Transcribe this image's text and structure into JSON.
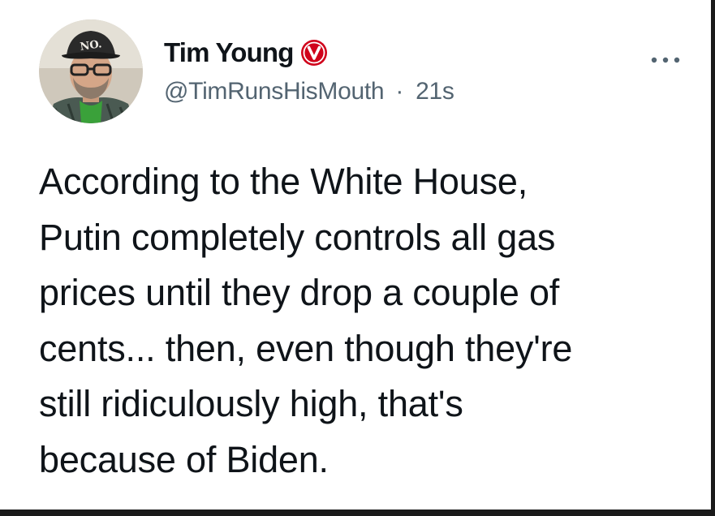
{
  "tweet": {
    "author": {
      "name": "Tim Young",
      "handle": "@TimRunsHisMouth",
      "avatar_hat_text": "NO.",
      "verified_icon": "verified-v-badge-icon",
      "verified_color": "#d0021b"
    },
    "separator": "·",
    "time_ago": "21s",
    "more_icon": "more-options-icon",
    "text_lines": [
      "According to the White House,",
      "Putin completely controls all gas",
      "prices until they drop a couple of",
      "cents... then, even though they're",
      "still ridiculously high, that's",
      "because of Biden."
    ]
  },
  "colors": {
    "text_primary": "#0f1419",
    "text_secondary": "#536471",
    "background": "#ffffff",
    "frame": "#1a1a1a"
  }
}
